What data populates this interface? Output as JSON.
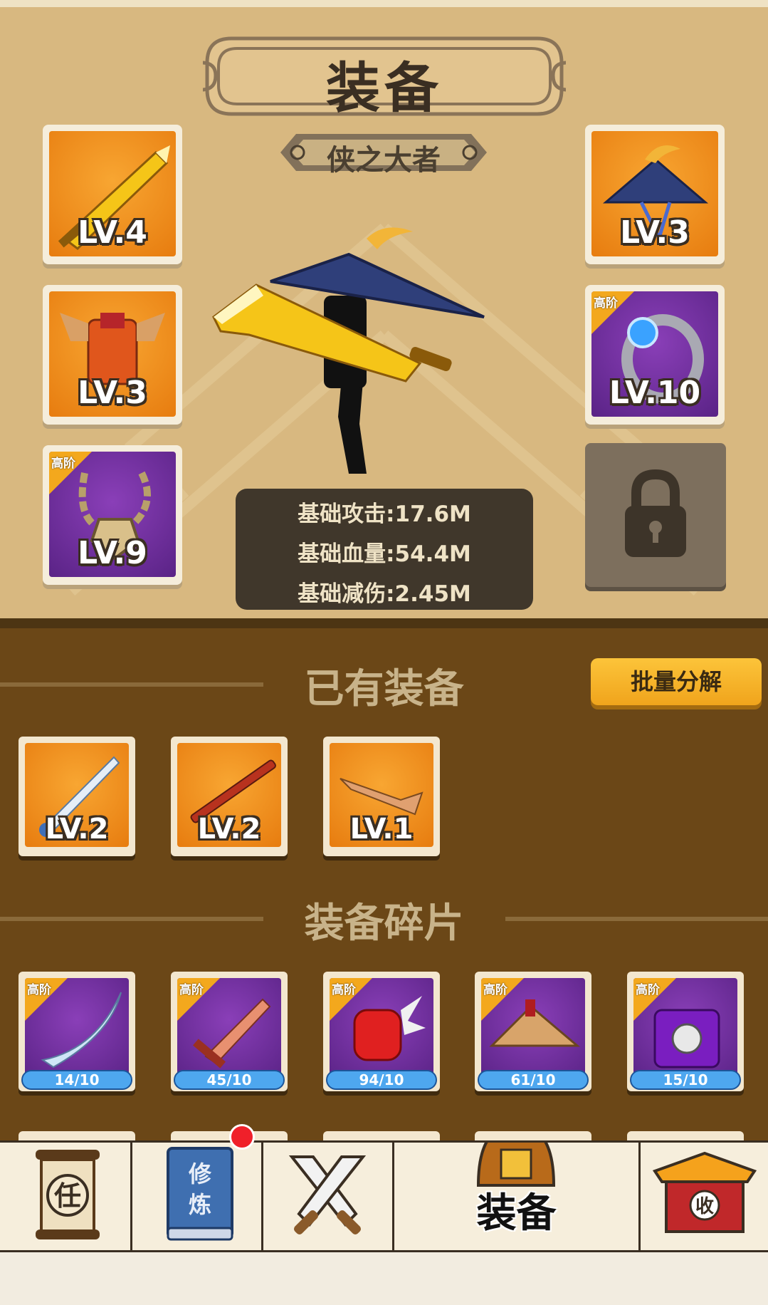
{
  "header": {
    "title": "装备",
    "subtitle": "侠之大者"
  },
  "left_slots": [
    {
      "level": "LV.4",
      "item": "sword",
      "tier": ""
    },
    {
      "level": "LV.3",
      "item": "armor",
      "tier": ""
    },
    {
      "level": "LV.9",
      "item": "necklace",
      "tier": "高阶"
    }
  ],
  "right_slots": [
    {
      "level": "LV.3",
      "item": "hat",
      "tier": ""
    },
    {
      "level": "LV.10",
      "item": "ring",
      "tier": "高阶"
    }
  ],
  "stats": [
    {
      "label": "基础攻击",
      "value": "17.6M",
      "text": "基础攻击:17.6M"
    },
    {
      "label": "基础血量",
      "value": "54.4M",
      "text": "基础血量:54.4M"
    },
    {
      "label": "基础减伤",
      "value": "2.45M",
      "text": "基础减伤:2.45M"
    }
  ],
  "owned": {
    "title": "已有装备",
    "button": "批量分解",
    "items": [
      {
        "level": "LV.2",
        "item": "blue-sword"
      },
      {
        "level": "LV.2",
        "item": "staff"
      },
      {
        "level": "LV.1",
        "item": "wooden-blade"
      }
    ]
  },
  "fragments": {
    "title": "装备碎片",
    "items": [
      {
        "tier": "高阶",
        "item": "curved-blade",
        "count": 14,
        "required": 10,
        "progress": "14/10"
      },
      {
        "tier": "高阶",
        "item": "broken-sword",
        "count": 45,
        "required": 10,
        "progress": "45/10"
      },
      {
        "tier": "高阶",
        "item": "spiked-gauntlet",
        "count": 94,
        "required": 10,
        "progress": "94/10"
      },
      {
        "tier": "高阶",
        "item": "straw-hat",
        "count": 61,
        "required": 10,
        "progress": "61/10"
      },
      {
        "tier": "高阶",
        "item": "purple-armor",
        "count": 15,
        "required": 10,
        "progress": "15/10"
      }
    ]
  },
  "nav": {
    "tabs": [
      {
        "id": "task",
        "icon": "scroll-icon",
        "glyph": "任"
      },
      {
        "id": "cultivate",
        "icon": "book-icon",
        "glyph1": "修",
        "glyph2": "炼",
        "badge": true
      },
      {
        "id": "battle",
        "icon": "crossed-swords-icon"
      },
      {
        "id": "equipment",
        "icon": "helmet-icon",
        "label": "装备",
        "active": true
      },
      {
        "id": "collect",
        "icon": "shop-icon",
        "glyph": "收"
      }
    ]
  },
  "colors": {
    "orange_slot": "#f39a24",
    "purple_slot": "#6f2ea0",
    "panel_bg": "#d8b880",
    "inventory_bg": "#6b4717",
    "accent_button": "#f7b42a"
  }
}
